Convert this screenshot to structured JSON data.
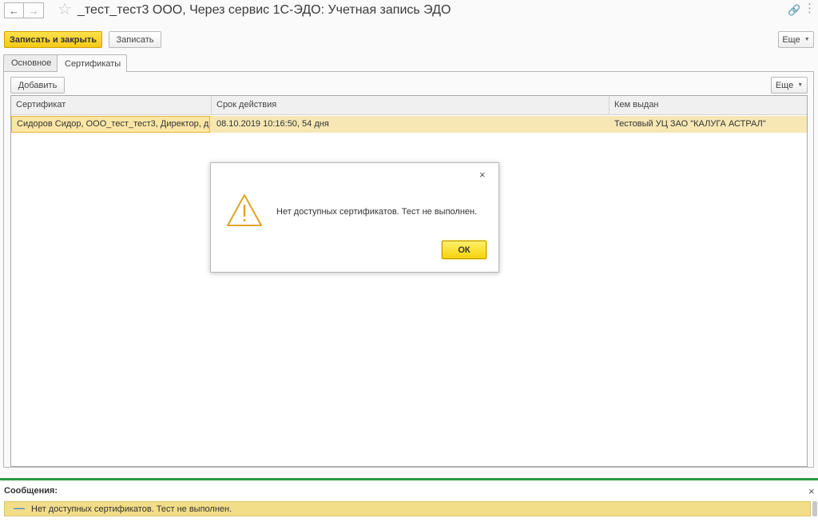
{
  "window": {
    "title": "_тест_тест3 ООО, Через сервис 1С-ЭДО: Учетная запись ЭДО",
    "back_icon": "arrow-left-icon",
    "forward_icon": "arrow-right-icon",
    "favorite_icon": "star-icon"
  },
  "toolbar": {
    "save_close_label": "Записать и закрыть",
    "save_label": "Записать",
    "more_label": "Еще"
  },
  "tabs": [
    {
      "label": "Основное",
      "active": false
    },
    {
      "label": "Сертификаты",
      "active": true
    }
  ],
  "panel_toolbar": {
    "add_label": "Добавить",
    "more_label": "Еще"
  },
  "table": {
    "columns": [
      "Сертификат",
      "Срок действия",
      "Кем выдан"
    ],
    "rows": [
      [
        "Сидоров Сидор, ООО_тест_тест3, Директор, д...",
        "08.10.2019 10:16:50, 54 дня",
        "Тестовый УЦ ЗАО \"КАЛУГА АСТРАЛ\""
      ]
    ]
  },
  "dialog": {
    "message": "Нет доступных сертификатов. Тест не выполнен.",
    "ok_label": "ОК",
    "close_symbol": "×"
  },
  "messages": {
    "title": "Сообщения:",
    "close_symbol": "×",
    "items": [
      "Нет доступных сертификатов. Тест не выполнен."
    ]
  },
  "colors": {
    "primary_button": "#f4c917",
    "selected_row": "#f6e7b4",
    "message_line": "#f2dd88",
    "separator_green": "#2b9a47",
    "warning_icon": "#e0a420"
  }
}
